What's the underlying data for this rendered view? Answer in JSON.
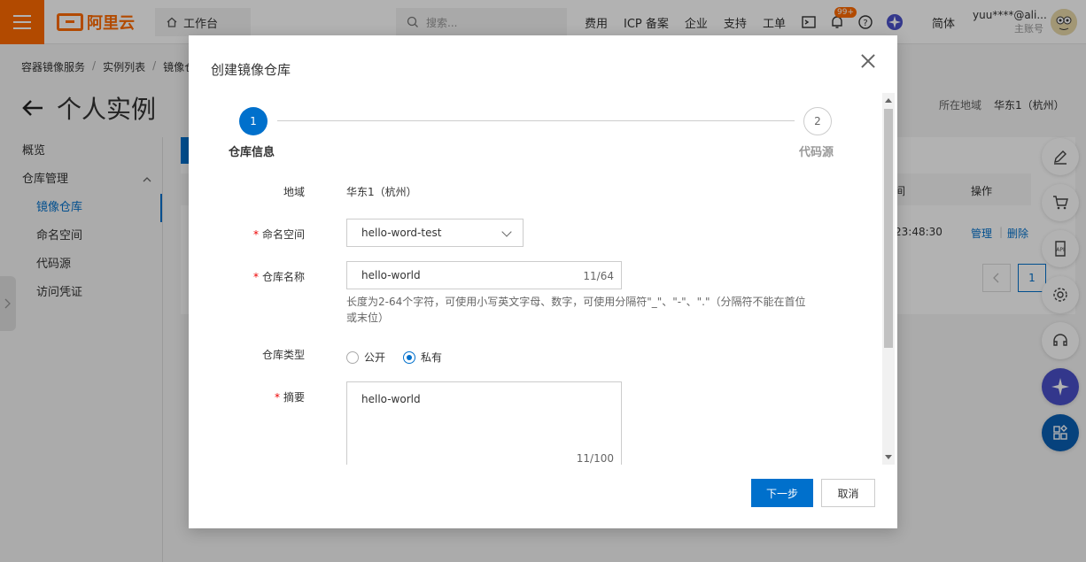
{
  "header": {
    "logo_text": "阿里云",
    "workbench": "工作台",
    "search_placeholder": "搜索...",
    "nav": [
      "费用",
      "ICP 备案",
      "企业",
      "支持",
      "工单"
    ],
    "badge": "99+",
    "lang": "简体",
    "user_name": "yuu****@ali...",
    "user_sub": "主账号"
  },
  "breadcrumb": [
    "容器镜像服务",
    "实例列表",
    "镜像仓"
  ],
  "page_title": "个人实例",
  "region_label": "所在地域",
  "region_value": "华东1（杭州）",
  "sidebar": {
    "items": [
      "概览",
      "仓库管理",
      "镜像仓库",
      "命名空间",
      "代码源",
      "访问凭证"
    ]
  },
  "table": {
    "op_header": "操作",
    "time_header_tail": "间",
    "time_value": "23:48:30",
    "manage": "管理",
    "delete": "删除",
    "page": "1"
  },
  "modal": {
    "title": "创建镜像仓库",
    "steps": [
      {
        "num": "1",
        "label": "仓库信息"
      },
      {
        "num": "2",
        "label": "代码源"
      }
    ],
    "region_label": "地域",
    "region_value": "华东1（杭州）",
    "namespace_label": "命名空间",
    "namespace_value": "hello-word-test",
    "repo_name_label": "仓库名称",
    "repo_name_value": "hello-world",
    "repo_name_count": "11/64",
    "repo_name_hint": "长度为2-64个字符，可使用小写英文字母、数字，可使用分隔符\"_\"、\"-\"、\".\"（分隔符不能在首位或末位）",
    "repo_type_label": "仓库类型",
    "repo_type_public": "公开",
    "repo_type_private": "私有",
    "summary_label": "摘要",
    "summary_value": "hello-world",
    "summary_count": "11/100",
    "next_button": "下一步",
    "cancel_button": "取消"
  }
}
